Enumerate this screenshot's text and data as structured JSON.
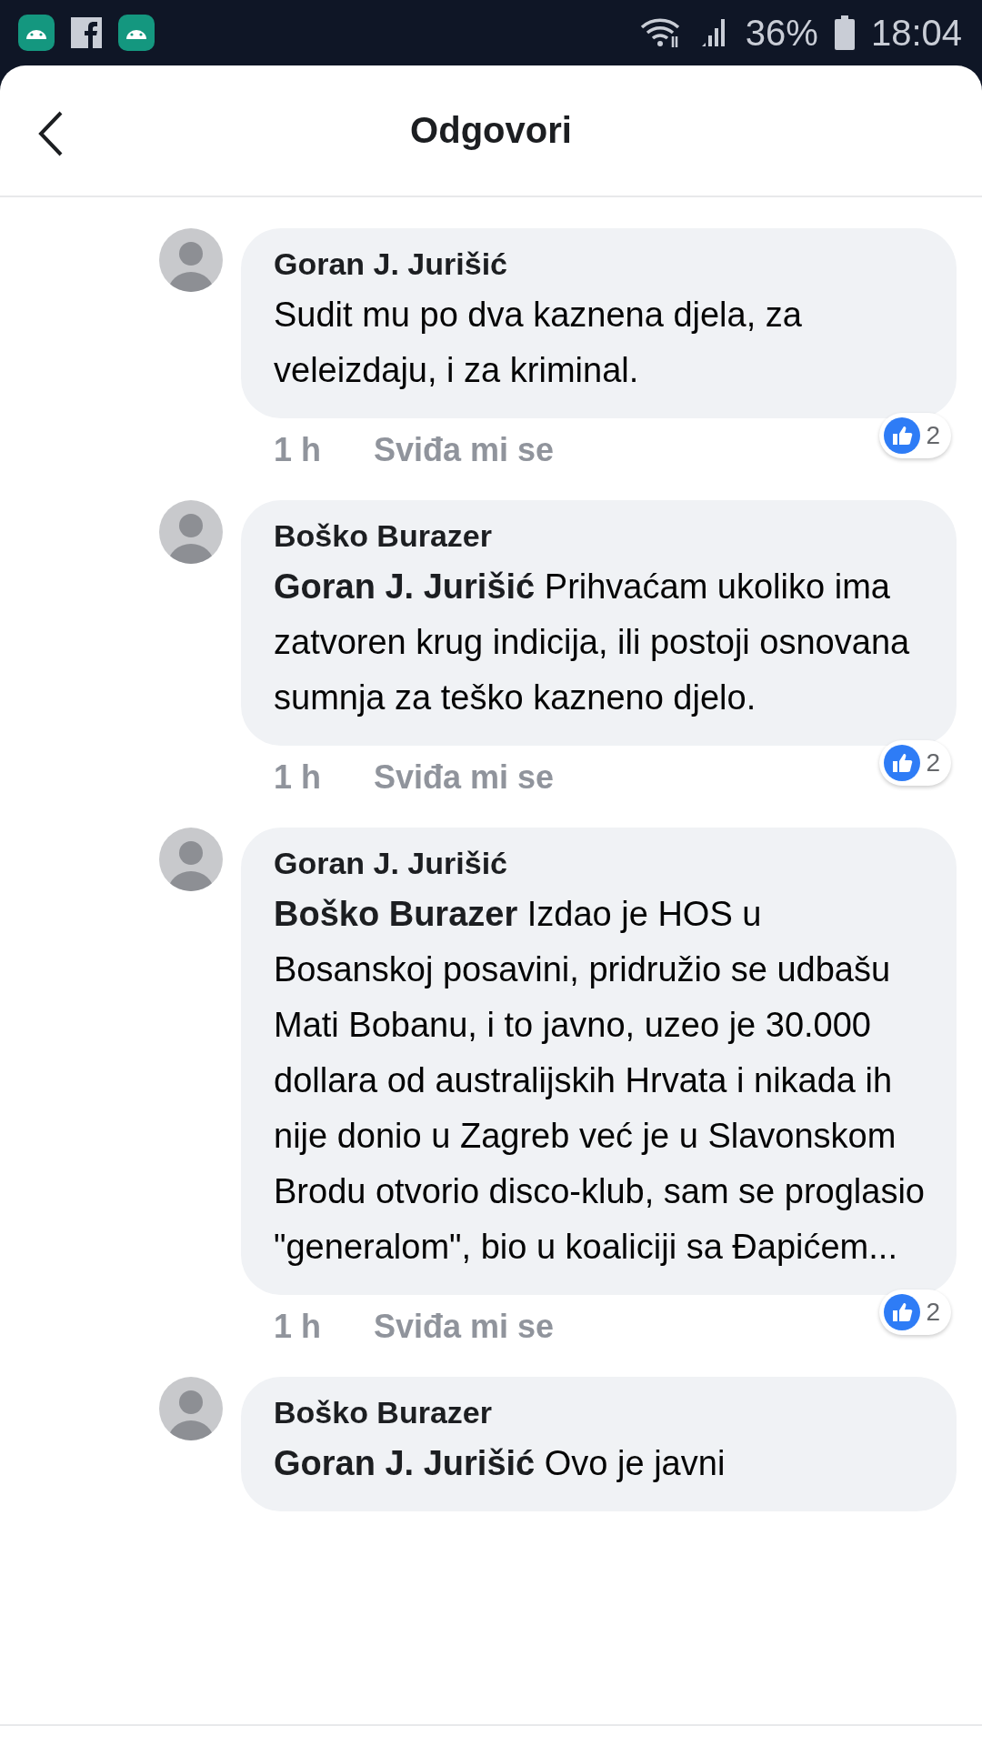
{
  "status_bar": {
    "battery": "36%",
    "time": "18:04"
  },
  "header": {
    "title": "Odgovori"
  },
  "comments": [
    {
      "author": "Goran J. Jurišić",
      "text": "Sudit mu po dva kaznena djela, za veleizdaju, i za kriminal.",
      "time": "1 h",
      "like_label": "Sviđa mi se",
      "reactions": "2"
    },
    {
      "author": "Boško Burazer",
      "text": "**Goran J. Jurišić** Prihvaćam ukoliko ima zatvoren krug indicija, ili postoji osnovana sumnja za teško kazneno djelo.",
      "time": "1 h",
      "like_label": "Sviđa mi se",
      "reactions": "2"
    },
    {
      "author": "Goran J. Jurišić",
      "text": "**Boško Burazer** Izdao je HOS u Bosanskoj posavini, pridružio se udbašu Mati Bobanu, i to javno, uzeo je 30.000 dollara od australijskih Hrvata i nikada ih nije donio u Zagreb već je u Slavonskom Brodu otvorio disco-klub, sam se proglasio \"generalom\", bio u koaliciji sa Đapićem...",
      "time": "1 h",
      "like_label": "Sviđa mi se",
      "reactions": "2"
    },
    {
      "author": "Boško Burazer",
      "text": "**Goran J. Jurišić** Ovo je javni"
    }
  ]
}
